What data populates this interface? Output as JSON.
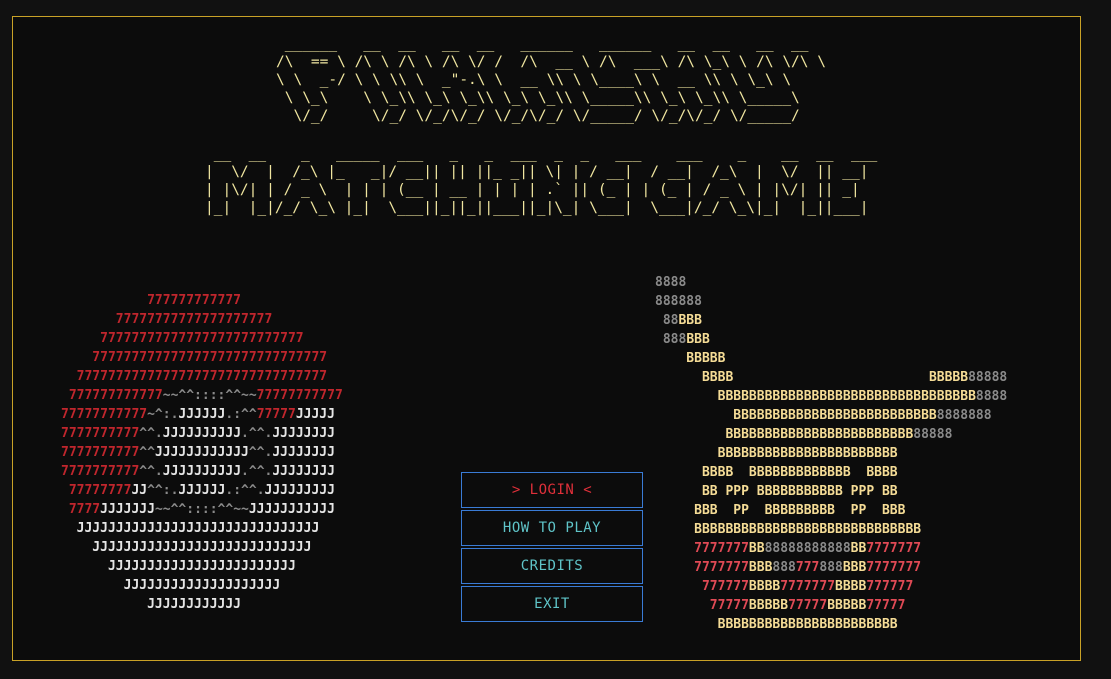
{
  "title": {
    "line1": [
      " ______   __  __   __  __   ______   ______   __  __   __  __",
      "/\\  == \\ /\\ \\ /\\ \\ /\\ \\/ /  /\\  __ \\ /\\  ___\\ /\\ \\_\\ \\ /\\ \\/\\ \\",
      "\\ \\  _-/ \\ \\ \\\\ \\  _\"-.\\ \\  __ \\\\ \\ \\____\\ \\  __ \\\\ \\ \\_\\ \\",
      " \\ \\_\\    \\ \\_\\\\ \\_\\ \\_\\\\ \\_\\ \\_\\\\ \\_____\\\\ \\_\\ \\_\\\\ \\_____\\",
      "  \\/_/     \\/_/ \\/_/\\/_/ \\/_/\\/_/ \\/_____/ \\/_/\\/_/ \\/_____/"
    ],
    "line2": [
      " __  __    _   _____  ___   _   _  ___  _  _   ___    ___    _    __  __  ___",
      "|  \\/  |  /_\\ |_   _|/ __|| || ||_ _|| \\| | / __|  / __|  /_\\  |  \\/  || __|",
      "| |\\/| | / _ \\  | | | (__ | __ | | | | .` || (_ | | (_ | / _ \\ | |\\/| || _|",
      "|_|  |_|/_/ \\_\\ |_|  \\___||_||_||___||_|\\_| \\___|  \\___|/_/ \\_\\|_|  |_||___|"
    ]
  },
  "art_left": [
    [
      [
        "           777777777777",
        "r"
      ]
    ],
    [
      [
        "       77777777777777777777",
        "r"
      ]
    ],
    [
      [
        "     77777777777777777777777777",
        "r"
      ]
    ],
    [
      [
        "    777777777777777777777777777777",
        "r"
      ]
    ],
    [
      [
        "  77777777777777777777777777777777",
        "r"
      ]
    ],
    [
      [
        " 777777777777",
        "r"
      ],
      [
        "~~^^::::^^~~",
        "g"
      ],
      [
        "77777777777",
        "r"
      ]
    ],
    [
      [
        "77777777777",
        "r"
      ],
      [
        "~^:.",
        "g"
      ],
      [
        "JJJJJJ",
        "w"
      ],
      [
        ".:^^",
        "g"
      ],
      [
        "77777",
        "r"
      ],
      [
        "JJJJJ",
        "w"
      ]
    ],
    [
      [
        "7777777777",
        "r"
      ],
      [
        "^^.",
        "g"
      ],
      [
        "JJJJJJJJJJ",
        "w"
      ],
      [
        ".^^.",
        "g"
      ],
      [
        "JJJJJJJJ",
        "w"
      ]
    ],
    [
      [
        "7777777777",
        "r"
      ],
      [
        "^^",
        "g"
      ],
      [
        "JJJJJJJJJJJJ",
        "w"
      ],
      [
        "^^.",
        "g"
      ],
      [
        "JJJJJJJJ",
        "w"
      ]
    ],
    [
      [
        "7777777777",
        "r"
      ],
      [
        "^^.",
        "g"
      ],
      [
        "JJJJJJJJJJ",
        "w"
      ],
      [
        ".^^.",
        "g"
      ],
      [
        "JJJJJJJJ",
        "w"
      ]
    ],
    [
      [
        " 77777777",
        "r"
      ],
      [
        "JJ",
        "w"
      ],
      [
        "^^:.",
        "g"
      ],
      [
        "JJJJJJ",
        "w"
      ],
      [
        ".:^^.",
        "g"
      ],
      [
        "JJJJJJJJJ",
        "w"
      ]
    ],
    [
      [
        " 7777",
        "r"
      ],
      [
        "JJJJJJJ",
        "w"
      ],
      [
        "~~^^::::^^~~",
        "g"
      ],
      [
        "JJJJJJJJJJJ",
        "w"
      ]
    ],
    [
      [
        "  JJJJJJJJJJJJJJJJJJJJJJJJJJJJJJJ",
        "w"
      ]
    ],
    [
      [
        "    JJJJJJJJJJJJJJJJJJJJJJJJJJJJ",
        "w"
      ]
    ],
    [
      [
        "      JJJJJJJJJJJJJJJJJJJJJJJJ",
        "w"
      ]
    ],
    [
      [
        "        JJJJJJJJJJJJJJJJJJJJ",
        "w"
      ]
    ],
    [
      [
        "           JJJJJJJJJJJJ",
        "w"
      ]
    ]
  ],
  "art_right": [
    [
      [
        "8888",
        "g"
      ]
    ],
    [
      [
        "888888",
        "g"
      ]
    ],
    [
      [
        " 88",
        "g"
      ],
      [
        "BBB",
        "c"
      ]
    ],
    [
      [
        " 888",
        "g"
      ],
      [
        "BBB",
        "c"
      ]
    ],
    [
      [
        "    BBBBB",
        "c"
      ]
    ],
    [
      [
        "      BBBB",
        "c"
      ],
      [
        "                         ",
        "c"
      ],
      [
        "BBBBB",
        "c"
      ],
      [
        "88888",
        "g"
      ]
    ],
    [
      [
        "        BBBBBBBBBBBBBBBBBBBBBBBBBBBBBBBBB",
        "c"
      ],
      [
        "8888",
        "g"
      ]
    ],
    [
      [
        "          BBBBBBBBBBBBBBBBBBBBBBBBBB",
        "c"
      ],
      [
        "8888888",
        "g"
      ]
    ],
    [
      [
        "         BBBBBBBBBBBBBBBBBBBBBBBB",
        "c"
      ],
      [
        "88888",
        "g"
      ]
    ],
    [
      [
        "        BBBBBBBBBBBBBBBBBBBBBBB",
        "c"
      ]
    ],
    [
      [
        "      BBBB  BBBBBBBBBBBBB  BBBB",
        "c"
      ]
    ],
    [
      [
        "      BB PPP BBBBBBBBBBB PPP BB",
        "c"
      ]
    ],
    [
      [
        "     BBB  PP  BBBBBBBBB  PP  BBB",
        "c"
      ]
    ],
    [
      [
        "     BBBBBBBBBBBBBBBBBBBBBBBBBBBBB",
        "c"
      ]
    ],
    [
      [
        "     7777777",
        "p"
      ],
      [
        "BB",
        "c"
      ],
      [
        "88888888888",
        "g"
      ],
      [
        "BB",
        "c"
      ],
      [
        "7777777",
        "p"
      ]
    ],
    [
      [
        "     7777777",
        "p"
      ],
      [
        "BBB",
        "c"
      ],
      [
        "888",
        "g"
      ],
      [
        "777",
        "p"
      ],
      [
        "888",
        "g"
      ],
      [
        "BBB",
        "c"
      ],
      [
        "7777777",
        "p"
      ]
    ],
    [
      [
        "      777777",
        "p"
      ],
      [
        "BBBB",
        "c"
      ],
      [
        "7777777",
        "p"
      ],
      [
        "BBBB",
        "c"
      ],
      [
        "777777",
        "p"
      ]
    ],
    [
      [
        "       77777",
        "p"
      ],
      [
        "BBBBB",
        "c"
      ],
      [
        "77777",
        "p"
      ],
      [
        "BBBBB",
        "c"
      ],
      [
        "77777",
        "p"
      ]
    ],
    [
      [
        "        BBBBBBBBBBBBBBBBBBBBBBB",
        "c"
      ]
    ]
  ],
  "menu": {
    "login": "> LOGIN <",
    "how_to_play": "HOW TO PLAY",
    "credits": "CREDITS",
    "exit": "EXIT"
  },
  "colors": {
    "border": "#c9a227",
    "title": "#f0e6a0",
    "red": "#c0262d",
    "gray": "#8a8a8a",
    "white": "#e6e6e6",
    "cream": "#f5dc96",
    "pink_red": "#e04a55",
    "button_border": "#3a7bd5",
    "button_text": "#5fc4c8",
    "selected_text": "#e0303a"
  }
}
